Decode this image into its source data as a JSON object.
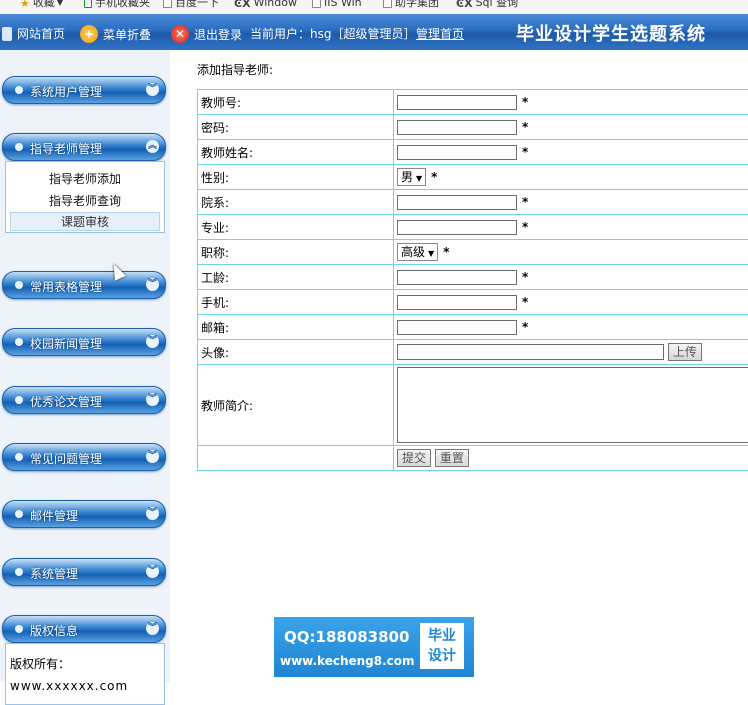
{
  "bookmarks": [
    {
      "label": "收藏",
      "icon": "star-icon"
    },
    {
      "label": "手机收藏夹",
      "icon": "phone-icon"
    },
    {
      "label": "百度一下",
      "icon": "page-icon"
    },
    {
      "label": "Window",
      "icon": "logo-icon"
    },
    {
      "label": "IIS Win",
      "icon": "page-icon"
    },
    {
      "label": "助学集团",
      "icon": "page-icon"
    },
    {
      "label": "Sql 查询",
      "icon": "logo-icon"
    }
  ],
  "header": {
    "home_label": "网站首页",
    "collapse_label": "菜单折叠",
    "logout_label": "退出登录",
    "current_user": "当前用户：hsg［超级管理员］",
    "admin_home_label": "管理首页",
    "system_title": "毕业设计学生选题系统",
    "bar_color": "#2a6cc0"
  },
  "sidebar": {
    "menus": [
      {
        "label": "系统用户管理",
        "expanded": false
      },
      {
        "label": "指导老师管理",
        "expanded": true,
        "items": [
          {
            "label": "指导老师添加"
          },
          {
            "label": "指导老师查询"
          },
          {
            "label": "课题审核",
            "active": true
          }
        ]
      },
      {
        "label": "常用表格管理",
        "expanded": false
      },
      {
        "label": "校园新闻管理",
        "expanded": false
      },
      {
        "label": "优秀论文管理",
        "expanded": false
      },
      {
        "label": "常见问题管理",
        "expanded": false
      },
      {
        "label": "邮件管理",
        "expanded": false
      },
      {
        "label": "系统管理",
        "expanded": false
      },
      {
        "label": "版权信息",
        "expanded": true,
        "copyright": {
          "line1": "版权所有：",
          "line2": "www.xxxxxx.com"
        }
      }
    ]
  },
  "form": {
    "title": "添加指导老师:",
    "required_mark": "*",
    "fields": {
      "teacher_no": {
        "label": "教师号:",
        "value": ""
      },
      "password": {
        "label": "密码:",
        "value": ""
      },
      "teacher_name": {
        "label": "教师姓名:",
        "value": ""
      },
      "gender": {
        "label": "性别:",
        "selected": "男"
      },
      "department": {
        "label": "院系:",
        "value": ""
      },
      "major": {
        "label": "专业:",
        "value": ""
      },
      "title": {
        "label": "职称:",
        "selected": "高级"
      },
      "seniority": {
        "label": "工龄:",
        "value": ""
      },
      "phone": {
        "label": "手机:",
        "value": ""
      },
      "email": {
        "label": "邮箱:",
        "value": ""
      },
      "avatar": {
        "label": "头像:",
        "upload_label": "上传"
      },
      "intro": {
        "label": "教师简介:",
        "value": ""
      }
    },
    "submit_label": "提交",
    "reset_label": "重置",
    "border_color": "#6ad6e8"
  },
  "watermark": {
    "qq": "QQ:188083800",
    "url": "www.kecheng8.com",
    "logo_line1": "毕业",
    "logo_line2": "设计"
  }
}
